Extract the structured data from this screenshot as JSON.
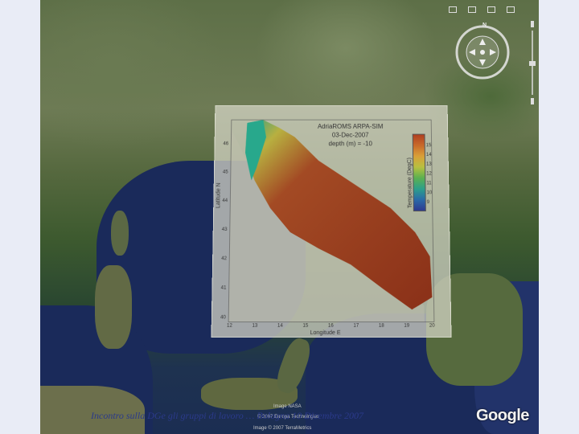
{
  "map": {
    "overlay": {
      "title_line1": "AdriaROMS ARPA-SIM",
      "title_line2": "03-Dec-2007",
      "title_line3": "depth (m) = -10",
      "colorbar_label": "Temperature (DegC)",
      "colorbar_ticks": [
        "15",
        "14",
        "13",
        "12",
        "11",
        "10",
        "9"
      ],
      "y_axis_label": "Latitude N",
      "x_axis_label": "Longitude E",
      "y_ticks": [
        "46",
        "45",
        "44",
        "43",
        "42",
        "41",
        "40"
      ],
      "x_ticks": [
        "12",
        "13",
        "14",
        "15",
        "16",
        "17",
        "18",
        "19",
        "20"
      ]
    },
    "compass_north": "N",
    "attribution": {
      "line1": "Image NASA",
      "line2": "© 2007 Europa Technologies",
      "line3": "Image © 2007 TerraMetrics"
    },
    "logo": "Google"
  },
  "caption": "Incontro sulla DGe gli gruppi di lavoro … Bologna 10 Dicembre 2007",
  "colors": {
    "background": "#e9ecf6",
    "caption": "#2b3a8a"
  }
}
